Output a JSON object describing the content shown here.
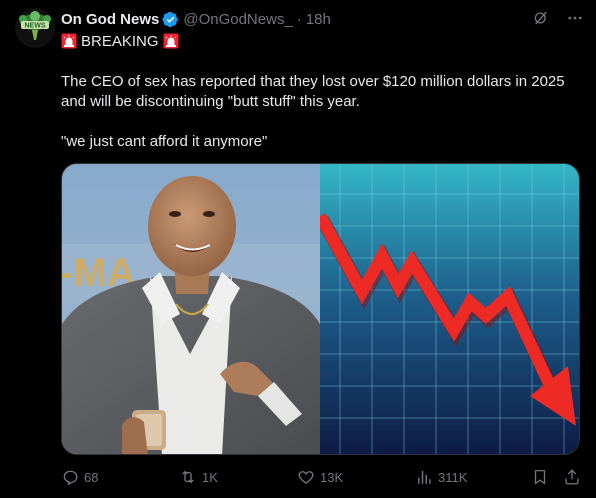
{
  "author": {
    "name": "On God News",
    "handle": "@OnGodNews_",
    "separator": "·",
    "time": "18h",
    "avatar_text": "NEWS"
  },
  "tweet": {
    "breaking_label": "BREAKING",
    "line1": "The CEO of sex has reported that they lost over $120 million dollars in 2025 and will be discontinuing \"butt stuff\" this year.",
    "line2": "\"we just cant afford it anymore\""
  },
  "media": {
    "left_sign_text": "-MA"
  },
  "metrics": {
    "replies": "68",
    "reposts": "1K",
    "likes": "13K",
    "views": "311K"
  },
  "colors": {
    "background": "#000000",
    "text": "#e7e9ea",
    "muted": "#71767b",
    "verified": "#1d9bf0",
    "siren": "#f4212e",
    "chart_arrow": "#ee2a24"
  },
  "icons": {
    "verified": "verified-badge-icon",
    "siren": "police-light-icon",
    "grok": "grok-icon",
    "more": "more-icon",
    "reply": "reply-icon",
    "repost": "repost-icon",
    "like": "heart-icon",
    "views": "views-icon",
    "bookmark": "bookmark-icon",
    "share": "share-icon"
  }
}
